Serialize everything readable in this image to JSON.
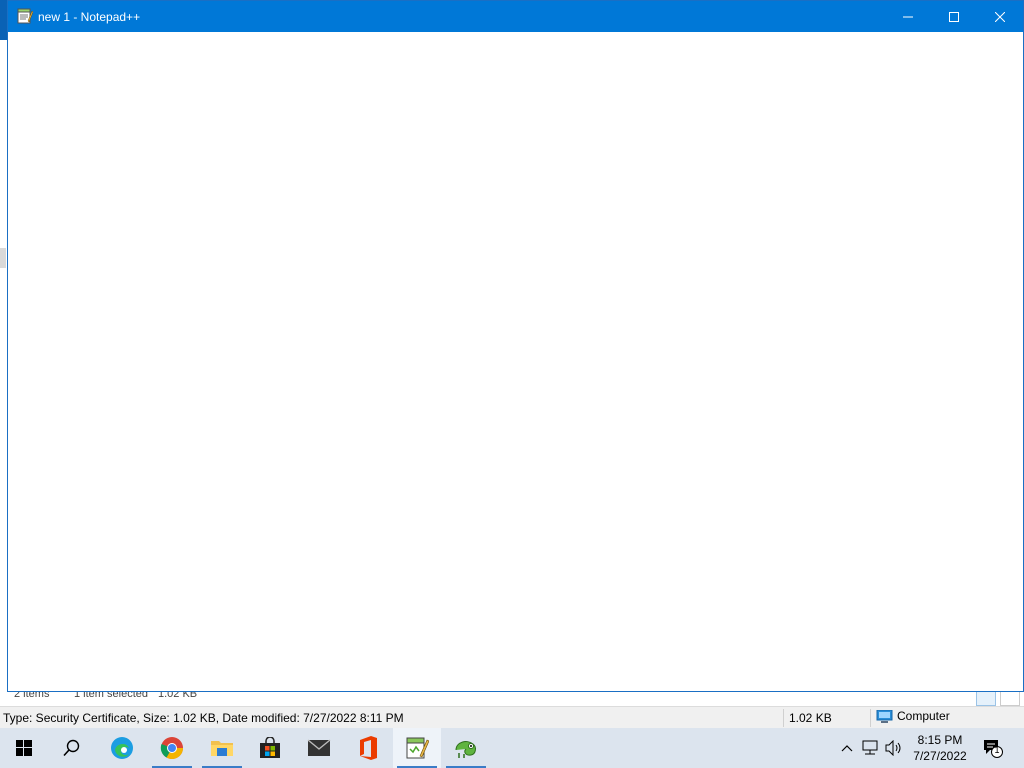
{
  "explorer_status": {
    "item_count": "2 items",
    "selection": "1 item selected",
    "selection_size": "1.02 KB"
  },
  "details_bar": {
    "description": "Type: Security Certificate, Size: 1.02 KB, Date modified: 7/27/2022 8:11 PM",
    "size": "1.02 KB",
    "zone": "Computer"
  },
  "notepad": {
    "title": "new 1 - Notepad++",
    "editor_text": ""
  },
  "taskbar": {
    "apps": [
      {
        "name": "Start",
        "icon": "windows-logo-icon"
      },
      {
        "name": "Search",
        "icon": "search-icon"
      },
      {
        "name": "Microsoft Edge",
        "icon": "edge-icon"
      },
      {
        "name": "Google Chrome",
        "icon": "chrome-icon"
      },
      {
        "name": "File Explorer",
        "icon": "folder-icon"
      },
      {
        "name": "Microsoft Store",
        "icon": "store-icon"
      },
      {
        "name": "Mail",
        "icon": "mail-icon"
      },
      {
        "name": "Office",
        "icon": "office-icon"
      },
      {
        "name": "Notepad++",
        "icon": "notepadpp-icon"
      },
      {
        "name": "Notepad++ plugin",
        "icon": "chameleon-icon"
      }
    ]
  },
  "clock": {
    "time": "8:15 PM",
    "date": "7/27/2022"
  },
  "notifications": {
    "count": "1"
  },
  "colors": {
    "titlebar": "#0078d7",
    "taskbar": "#dce4ee",
    "accent": "#3a7cc7"
  }
}
